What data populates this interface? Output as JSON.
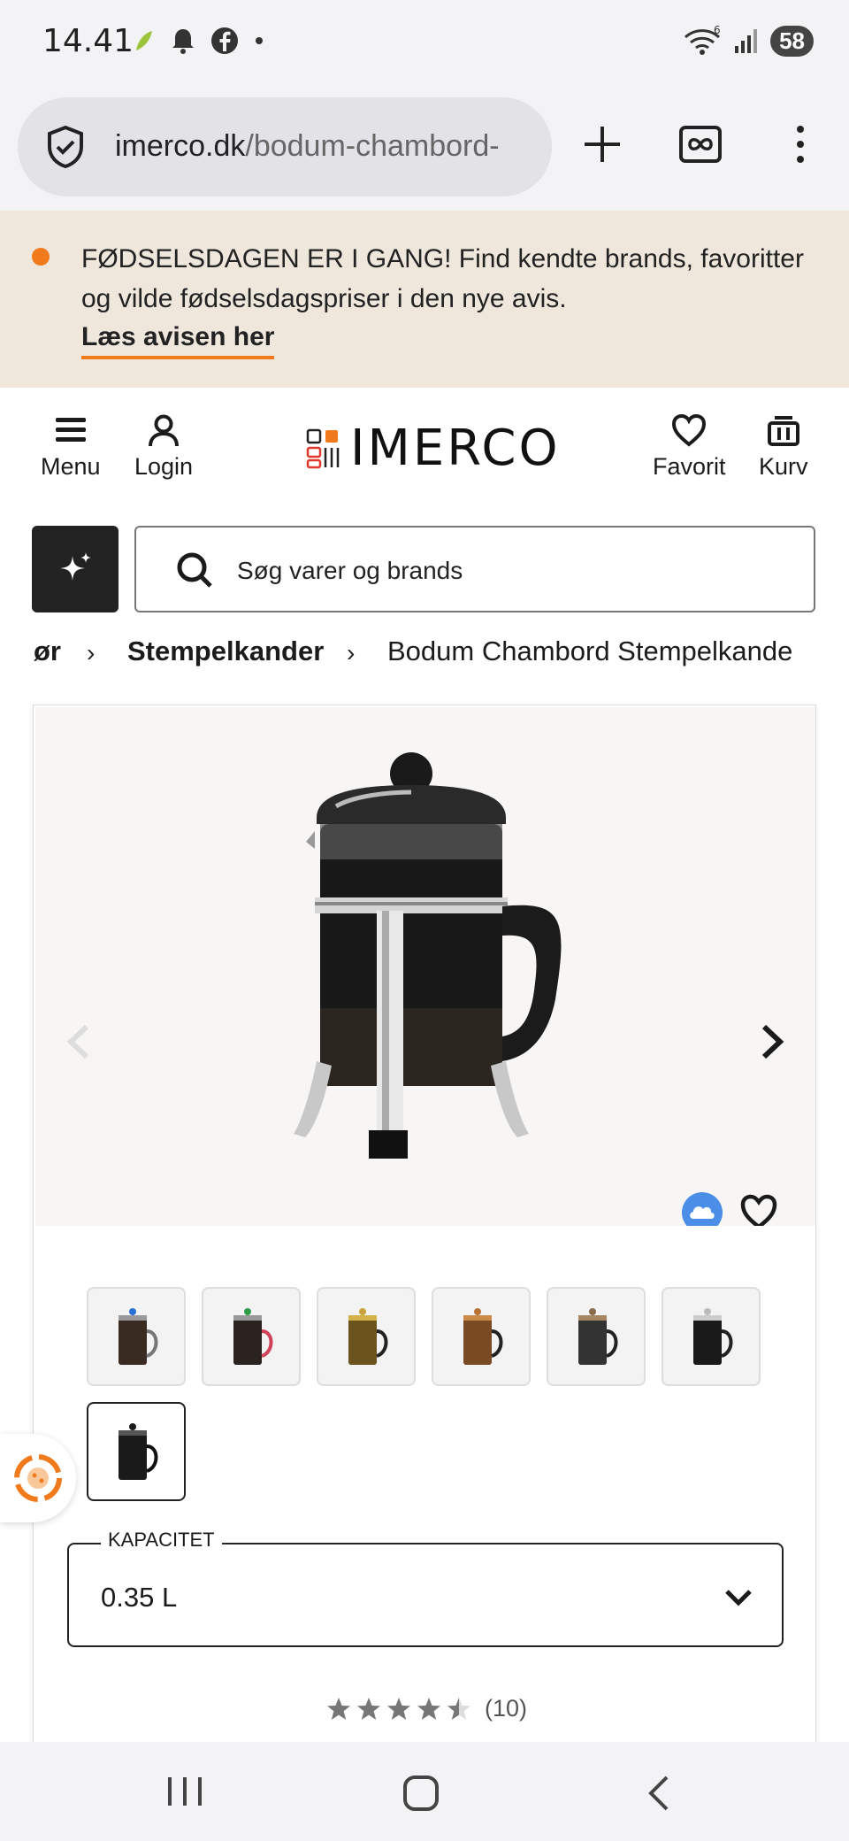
{
  "status_bar": {
    "time": "14.41",
    "battery": "58",
    "wifi_badge": "6"
  },
  "browser": {
    "url_host": "imerco.dk",
    "url_path": "/bodum-chambord-"
  },
  "promo": {
    "text": "FØDSELSDAGEN ER I GANG! Find kendte brands, favoritter og vilde fødselsdagspriser i den nye avis.",
    "link": "Læs avisen her"
  },
  "header": {
    "menu_label": "Menu",
    "login_label": "Login",
    "logo_text": "IMERCO",
    "favorite_label": "Favorit",
    "cart_label": "Kurv"
  },
  "search": {
    "placeholder": "Søg varer og brands"
  },
  "breadcrumb": {
    "items": [
      "ør",
      "Stempelkander",
      "Bodum Chambord Stempelkande"
    ]
  },
  "product": {
    "selected_thumbnail": 7,
    "thumbnail_count": 7,
    "capacity_label": "KAPACITET",
    "capacity_value": "0.35 L",
    "rating_value": 4.5,
    "rating_count": "(10)"
  },
  "colors": {
    "accent": "#f07a1c",
    "promo_bg": "#efe6dc",
    "dark": "#222222"
  }
}
